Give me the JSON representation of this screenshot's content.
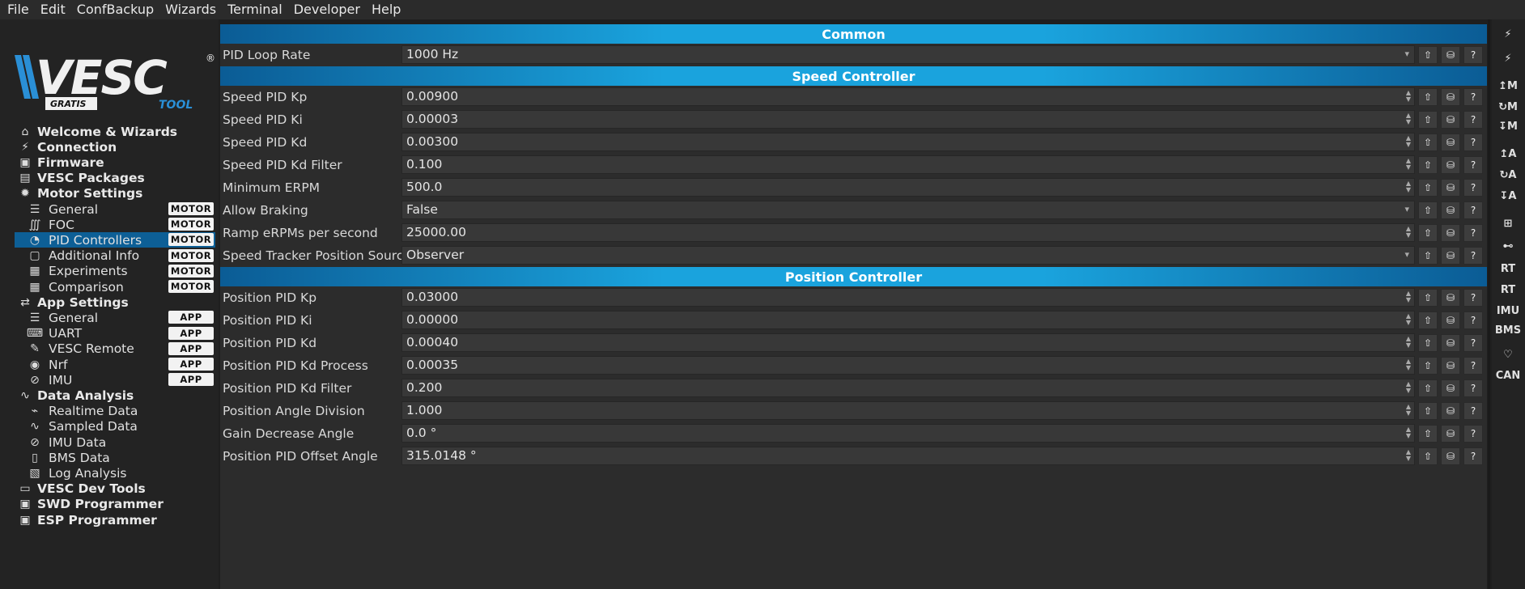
{
  "menu": [
    "File",
    "Edit",
    "ConfBackup",
    "Wizards",
    "Terminal",
    "Developer",
    "Help"
  ],
  "logo": {
    "brand": "VESC",
    "sub_left": "GRATIS",
    "sub_right": "TOOL",
    "reg": "®"
  },
  "nav": [
    {
      "label": "Welcome & Wizards",
      "type": "top",
      "icon": "home-icon",
      "glyph": "⌂"
    },
    {
      "label": "Connection",
      "type": "top",
      "icon": "plug-icon",
      "glyph": "⚡"
    },
    {
      "label": "Firmware",
      "type": "top",
      "icon": "chip-icon",
      "glyph": "▣"
    },
    {
      "label": "VESC Packages",
      "type": "top",
      "icon": "package-icon",
      "glyph": "▤"
    },
    {
      "label": "Motor Settings",
      "type": "top",
      "icon": "motor-icon",
      "glyph": "✹"
    },
    {
      "label": "General",
      "type": "sub",
      "icon": "sliders-icon",
      "glyph": "☰",
      "badge": "MOTOR"
    },
    {
      "label": "FOC",
      "type": "sub",
      "icon": "coil-icon",
      "glyph": "∭",
      "badge": "MOTOR"
    },
    {
      "label": "PID Controllers",
      "type": "sub",
      "icon": "gauge-icon",
      "glyph": "◔",
      "badge": "MOTOR",
      "active": true
    },
    {
      "label": "Additional Info",
      "type": "sub",
      "icon": "info-icon",
      "glyph": "▢",
      "badge": "MOTOR"
    },
    {
      "label": "Experiments",
      "type": "sub",
      "icon": "calculator-icon",
      "glyph": "▦",
      "badge": "MOTOR"
    },
    {
      "label": "Comparison",
      "type": "sub",
      "icon": "calculator-icon",
      "glyph": "▦",
      "badge": "MOTOR"
    },
    {
      "label": "App Settings",
      "type": "top",
      "icon": "arrows-icon",
      "glyph": "⇄"
    },
    {
      "label": "General",
      "type": "sub",
      "icon": "sliders-icon",
      "glyph": "☰",
      "badge": "APP"
    },
    {
      "label": "UART",
      "type": "sub",
      "icon": "keyboard-icon",
      "glyph": "⌨",
      "badge": "APP"
    },
    {
      "label": "VESC Remote",
      "type": "sub",
      "icon": "remote-icon",
      "glyph": "✎",
      "badge": "APP"
    },
    {
      "label": "Nrf",
      "type": "sub",
      "icon": "wireless-icon",
      "glyph": "◉",
      "badge": "APP"
    },
    {
      "label": "IMU",
      "type": "sub",
      "icon": "imu-icon",
      "glyph": "⊘",
      "badge": "APP"
    },
    {
      "label": "Data Analysis",
      "type": "top",
      "icon": "chart-icon",
      "glyph": "∿"
    },
    {
      "label": "Realtime Data",
      "type": "sub",
      "icon": "realtime-icon",
      "glyph": "⌁"
    },
    {
      "label": "Sampled Data",
      "type": "sub",
      "icon": "sampled-icon",
      "glyph": "∿"
    },
    {
      "label": "IMU Data",
      "type": "sub",
      "icon": "imu-icon",
      "glyph": "⊘"
    },
    {
      "label": "BMS Data",
      "type": "sub",
      "icon": "battery-icon",
      "glyph": "▯"
    },
    {
      "label": "Log Analysis",
      "type": "sub",
      "icon": "map-icon",
      "glyph": "▧"
    },
    {
      "label": "VESC Dev Tools",
      "type": "top",
      "icon": "terminal-icon",
      "glyph": "▭"
    },
    {
      "label": "SWD Programmer",
      "type": "top",
      "icon": "chip-icon",
      "glyph": "▣"
    },
    {
      "label": "ESP Programmer",
      "type": "top",
      "icon": "chip-icon",
      "glyph": "▣"
    }
  ],
  "sections": [
    {
      "title": "Common",
      "rows": [
        {
          "label": "PID Loop Rate",
          "value": "1000 Hz",
          "kind": "dropdown"
        }
      ]
    },
    {
      "title": "Speed Controller",
      "rows": [
        {
          "label": "Speed PID Kp",
          "value": "0.00900",
          "kind": "spin"
        },
        {
          "label": "Speed PID Ki",
          "value": "0.00003",
          "kind": "spin"
        },
        {
          "label": "Speed PID Kd",
          "value": "0.00300",
          "kind": "spin"
        },
        {
          "label": "Speed PID Kd Filter",
          "value": "0.100",
          "kind": "spin"
        },
        {
          "label": "Minimum ERPM",
          "value": "500.0",
          "kind": "spin"
        },
        {
          "label": "Allow Braking",
          "value": "False",
          "kind": "dropdown"
        },
        {
          "label": "Ramp eRPMs per second",
          "value": "25000.00",
          "kind": "spin"
        },
        {
          "label": "Speed Tracker Position Source",
          "value": "Observer",
          "kind": "dropdown"
        }
      ]
    },
    {
      "title": "Position Controller",
      "rows": [
        {
          "label": "Position PID Kp",
          "value": "0.03000",
          "kind": "spin"
        },
        {
          "label": "Position PID Ki",
          "value": "0.00000",
          "kind": "spin"
        },
        {
          "label": "Position PID Kd",
          "value": "0.00040",
          "kind": "spin"
        },
        {
          "label": "Position PID Kd Process",
          "value": "0.00035",
          "kind": "spin"
        },
        {
          "label": "Position PID Kd Filter",
          "value": "0.200",
          "kind": "spin"
        },
        {
          "label": "Position Angle Division",
          "value": "1.000",
          "kind": "spin"
        },
        {
          "label": "Gain Decrease Angle",
          "value": "0.0 °",
          "kind": "spin"
        },
        {
          "label": "Position PID Offset Angle",
          "value": "315.0148 °",
          "kind": "spin"
        }
      ]
    }
  ],
  "row_buttons": [
    {
      "name": "upload-icon",
      "glyph": "⇧"
    },
    {
      "name": "storage-icon",
      "glyph": "⛁"
    },
    {
      "name": "help-icon",
      "glyph": "?"
    }
  ],
  "right_toolbar": [
    {
      "name": "connect-icon",
      "glyph": "⚡"
    },
    {
      "name": "disconnect-icon",
      "glyph": "⚡"
    },
    {
      "name": "read-motor-config-icon",
      "glyph": "↥M"
    },
    {
      "name": "read-default-motor-config-icon",
      "glyph": "↻M"
    },
    {
      "name": "write-motor-config-icon",
      "glyph": "↧M"
    },
    {
      "name": "read-app-config-icon",
      "glyph": "↥A"
    },
    {
      "name": "read-default-app-config-icon",
      "glyph": "↻A"
    },
    {
      "name": "write-app-config-icon",
      "glyph": "↧A"
    },
    {
      "name": "can-network-icon",
      "glyph": "⊞"
    },
    {
      "name": "gamepad-icon",
      "glyph": "⊷"
    },
    {
      "name": "realtime-data-icon",
      "glyph": "RT"
    },
    {
      "name": "realtime-app-data-icon",
      "glyph": "RT"
    },
    {
      "name": "imu-data-icon",
      "glyph": "IMU"
    },
    {
      "name": "bms-data-icon",
      "glyph": "BMS"
    },
    {
      "name": "heart-icon",
      "glyph": "♡"
    },
    {
      "name": "can-fwd-icon",
      "glyph": "CAN"
    }
  ]
}
